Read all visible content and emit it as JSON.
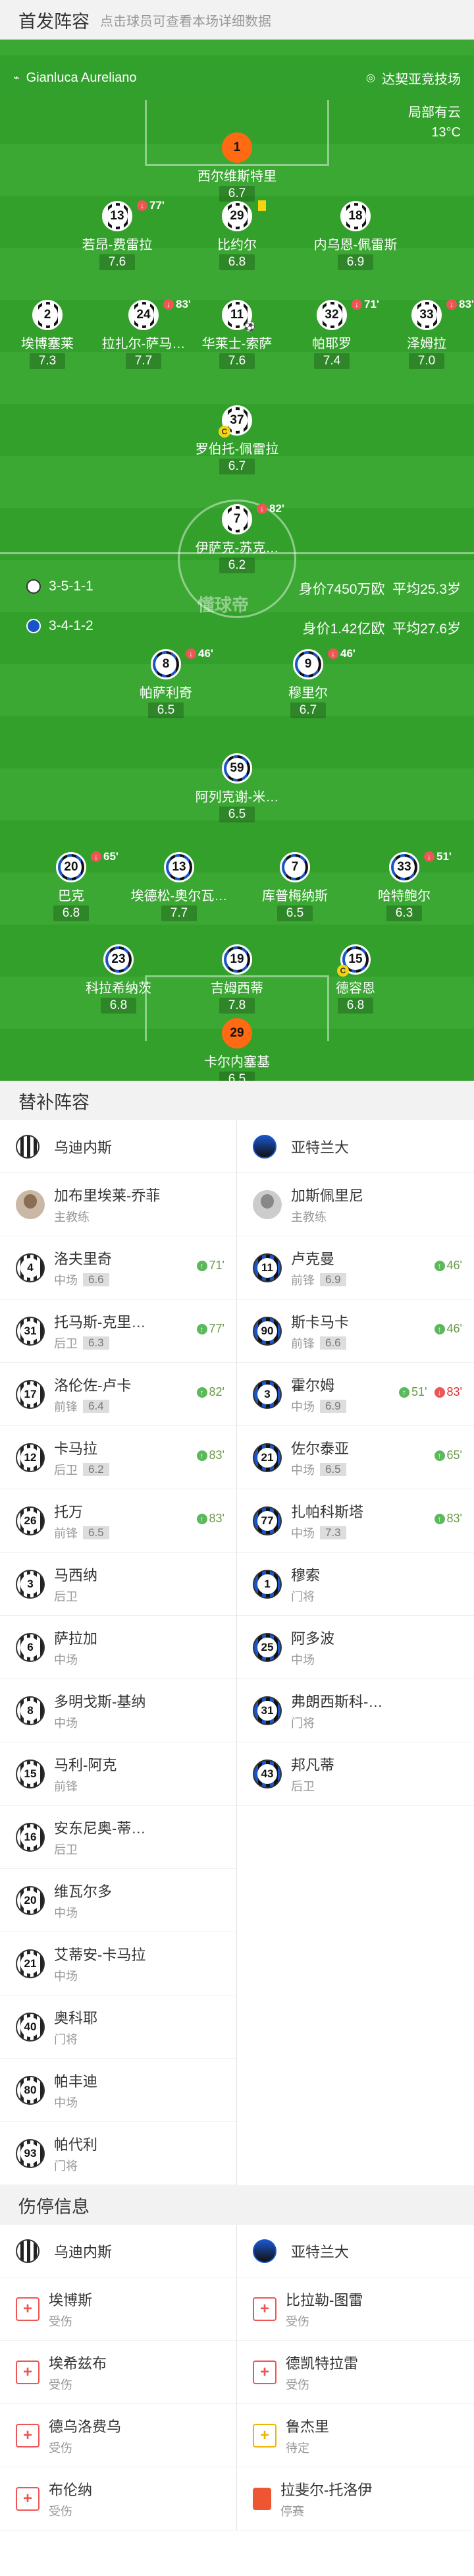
{
  "lineup_header": {
    "title": "首发阵容",
    "subtitle": "点击球员可查看本场详细数据"
  },
  "pitch": {
    "referee": "Gianluca Aureliano",
    "venue": "达契亚竞技场",
    "weather_desc": "局部有云",
    "temperature": "13°C",
    "watermark": "懂球帝",
    "home_formation": "3-5-1-1",
    "home_value": "身价7450万欧",
    "home_age": "平均25.3岁",
    "away_formation": "3-4-1-2",
    "away_value": "身价1.42亿欧",
    "away_age": "平均27.6岁"
  },
  "home_players": [
    {
      "num": "1",
      "name": "西尔维斯特里",
      "rating": "6.7",
      "gk": true
    },
    {
      "num": "13",
      "name": "若昂-费雷拉",
      "rating": "7.6",
      "badge": "77'"
    },
    {
      "num": "29",
      "name": "比约尔",
      "rating": "6.8"
    },
    {
      "num": "18",
      "name": "内乌恩-佩雷斯",
      "rating": "6.9"
    },
    {
      "num": "2",
      "name": "埃博塞莱",
      "rating": "7.3"
    },
    {
      "num": "24",
      "name": "拉扎尔-萨马…",
      "rating": "7.7",
      "badge": "83'"
    },
    {
      "num": "11",
      "name": "华莱士-索萨",
      "rating": "7.6"
    },
    {
      "num": "32",
      "name": "帕耶罗",
      "rating": "7.4",
      "badge": "71'"
    },
    {
      "num": "33",
      "name": "泽姆拉",
      "rating": "7.0",
      "badge": "83'"
    },
    {
      "num": "37",
      "name": "罗伯托-佩雷拉",
      "rating": "6.7"
    },
    {
      "num": "7",
      "name": "伊萨克-苏克…",
      "rating": "6.2",
      "badge": "82'"
    }
  ],
  "away_players": [
    {
      "num": "8",
      "name": "帕萨利奇",
      "rating": "6.5",
      "badge": "46'"
    },
    {
      "num": "9",
      "name": "穆里尔",
      "rating": "6.7",
      "badge": "46'"
    },
    {
      "num": "59",
      "name": "阿列克谢-米…",
      "rating": "6.5"
    },
    {
      "num": "20",
      "name": "巴克",
      "rating": "6.8",
      "badge": "65'"
    },
    {
      "num": "13",
      "name": "埃德松-奥尔瓦…",
      "rating": "7.7"
    },
    {
      "num": "7",
      "name": "库普梅纳斯",
      "rating": "6.5"
    },
    {
      "num": "33",
      "name": "哈特鲍尔",
      "rating": "6.3",
      "badge": "51'"
    },
    {
      "num": "23",
      "name": "科拉希纳茨",
      "rating": "6.8"
    },
    {
      "num": "19",
      "name": "吉姆西蒂",
      "rating": "7.8"
    },
    {
      "num": "15",
      "name": "德容恩",
      "rating": "6.8"
    },
    {
      "num": "29",
      "name": "卡尔内塞基",
      "rating": "6.5",
      "gk": true
    }
  ],
  "subs_header": {
    "title": "替补阵容"
  },
  "subs": {
    "home_team": "乌迪内斯",
    "away_team": "亚特兰大",
    "home_coach": {
      "name": "加布里埃莱-乔菲",
      "role": "主教练"
    },
    "away_coach": {
      "name": "加斯佩里尼",
      "role": "主教练"
    },
    "home": [
      {
        "num": "4",
        "name": "洛夫里奇",
        "pos": "中场",
        "rating": "6.6",
        "in": "71'"
      },
      {
        "num": "31",
        "name": "托马斯-克里…",
        "pos": "后卫",
        "rating": "6.3",
        "in": "77'"
      },
      {
        "num": "17",
        "name": "洛伦佐-卢卡",
        "pos": "前锋",
        "rating": "6.4",
        "in": "82'"
      },
      {
        "num": "12",
        "name": "卡马拉",
        "pos": "后卫",
        "rating": "6.2",
        "in": "83'"
      },
      {
        "num": "26",
        "name": "托万",
        "pos": "前锋",
        "rating": "6.5",
        "in": "83'"
      },
      {
        "num": "3",
        "name": "马西纳",
        "pos": "后卫"
      },
      {
        "num": "6",
        "name": "萨拉加",
        "pos": "中场"
      },
      {
        "num": "8",
        "name": "多明戈斯-基纳",
        "pos": "中场"
      },
      {
        "num": "15",
        "name": "马利-阿克",
        "pos": "前锋"
      },
      {
        "num": "16",
        "name": "安东尼奥-蒂…",
        "pos": "后卫"
      },
      {
        "num": "20",
        "name": "维瓦尔多",
        "pos": "中场"
      },
      {
        "num": "21",
        "name": "艾蒂安-卡马拉",
        "pos": "中场"
      },
      {
        "num": "40",
        "name": "奥科耶",
        "pos": "门将"
      },
      {
        "num": "80",
        "name": "帕丰迪",
        "pos": "中场"
      },
      {
        "num": "93",
        "name": "帕代利",
        "pos": "门将"
      }
    ],
    "away": [
      {
        "num": "11",
        "name": "卢克曼",
        "pos": "前锋",
        "rating": "6.9",
        "in": "46'"
      },
      {
        "num": "90",
        "name": "斯卡马卡",
        "pos": "前锋",
        "rating": "6.6",
        "in": "46'"
      },
      {
        "num": "3",
        "name": "霍尔姆",
        "pos": "中场",
        "rating": "6.9",
        "in": "51'",
        "out": "83'"
      },
      {
        "num": "21",
        "name": "佐尔泰亚",
        "pos": "中场",
        "rating": "6.5",
        "in": "65'"
      },
      {
        "num": "77",
        "name": "扎帕科斯塔",
        "pos": "中场",
        "rating": "7.3",
        "in": "83'"
      },
      {
        "num": "1",
        "name": "穆索",
        "pos": "门将"
      },
      {
        "num": "25",
        "name": "阿多波",
        "pos": "中场"
      },
      {
        "num": "31",
        "name": "弗朗西斯科-…",
        "pos": "门将"
      },
      {
        "num": "43",
        "name": "邦凡蒂",
        "pos": "后卫"
      }
    ]
  },
  "injury_header": {
    "title": "伤停信息"
  },
  "injuries": {
    "home_team": "乌迪内斯",
    "away_team": "亚特兰大",
    "home": [
      {
        "name": "埃博斯",
        "status": "受伤"
      },
      {
        "name": "埃希兹布",
        "status": "受伤"
      },
      {
        "name": "德乌洛费乌",
        "status": "受伤"
      },
      {
        "name": "布伦纳",
        "status": "受伤"
      }
    ],
    "away": [
      {
        "name": "比拉勒-图雷",
        "status": "受伤"
      },
      {
        "name": "德凯特拉雷",
        "status": "受伤"
      },
      {
        "name": "鲁杰里",
        "status": "待定"
      },
      {
        "name": "拉斐尔-托洛伊",
        "status": "停赛"
      }
    ]
  }
}
